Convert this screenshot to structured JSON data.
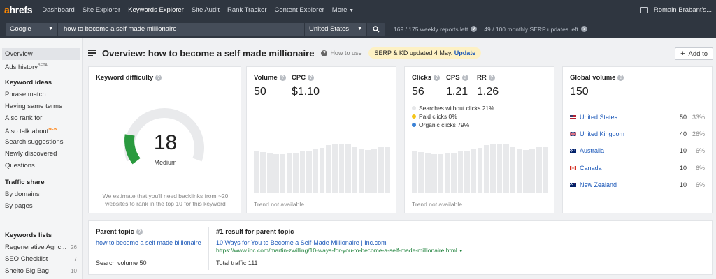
{
  "nav": {
    "logo_a": "a",
    "logo_rest": "hrefs",
    "links": [
      "Dashboard",
      "Site Explorer",
      "Keywords Explorer",
      "Site Audit",
      "Rank Tracker",
      "Content Explorer",
      "More"
    ],
    "user": "Romain Brabant's..."
  },
  "search": {
    "engine": "Google",
    "query": "how to become a self made millionaire",
    "country": "United States",
    "weekly_reports": "169 / 175 weekly reports left",
    "serp_updates": "49 / 100 monthly SERP updates left"
  },
  "sidebar": {
    "overview": "Overview",
    "ads_history": "Ads history",
    "ads_history_sup": "BETA",
    "keyword_ideas_head": "Keyword ideas",
    "keyword_ideas": [
      "Phrase match",
      "Having same terms",
      "Also rank for",
      "Also talk about",
      "Search suggestions",
      "Newly discovered",
      "Questions"
    ],
    "new_badge": "NEW",
    "traffic_share_head": "Traffic share",
    "traffic_share": [
      "By domains",
      "By pages"
    ],
    "keywords_lists_head": "Keywords lists",
    "lists": [
      {
        "name": "Regenerative Agric...",
        "count": "26"
      },
      {
        "name": "SEO Checklist",
        "count": "7"
      },
      {
        "name": "Shelto Big Bag",
        "count": "10"
      }
    ]
  },
  "header": {
    "title": "Overview: how to become a self made millionaire",
    "how_to_use": "How to use",
    "badge_text": "SERP & KD updated 4 May.",
    "badge_link": "Update",
    "add_to": "Add to"
  },
  "kd": {
    "title": "Keyword difficulty",
    "value": "18",
    "label": "Medium",
    "level": 0.18,
    "note": "We estimate that you'll need backlinks from ~20 websites to rank in the top 10 for this keyword"
  },
  "volume": {
    "title": "Volume",
    "value": "50",
    "cpc_title": "CPC",
    "cpc_value": "$1.10",
    "trend": "Trend not available",
    "bars": [
      0.52,
      0.51,
      0.5,
      0.49,
      0.49,
      0.5,
      0.5,
      0.52,
      0.53,
      0.56,
      0.57,
      0.6,
      0.62,
      0.62,
      0.62,
      0.58,
      0.55,
      0.54,
      0.55,
      0.58,
      0.58
    ]
  },
  "clicks": {
    "title": "Clicks",
    "value": "56",
    "cps_title": "CPS",
    "cps_value": "1.21",
    "rr_title": "RR",
    "rr_value": "1.26",
    "legend": [
      {
        "label": "Searches without clicks 21%",
        "color": "#e6e7e9"
      },
      {
        "label": "Paid clicks 0%",
        "color": "#f5c518"
      },
      {
        "label": "Organic clicks 79%",
        "color": "#3b82d6"
      }
    ],
    "trend": "Trend not available",
    "bars": [
      0.52,
      0.51,
      0.5,
      0.49,
      0.49,
      0.5,
      0.5,
      0.52,
      0.53,
      0.56,
      0.57,
      0.6,
      0.62,
      0.62,
      0.62,
      0.58,
      0.55,
      0.54,
      0.55,
      0.58,
      0.58
    ]
  },
  "global": {
    "title": "Global volume",
    "value": "150",
    "rows": [
      {
        "country": "United States",
        "vol": "50",
        "pct": "33%",
        "flag": "us"
      },
      {
        "country": "United Kingdom",
        "vol": "40",
        "pct": "26%",
        "flag": "uk"
      },
      {
        "country": "Australia",
        "vol": "10",
        "pct": "6%",
        "flag": "au"
      },
      {
        "country": "Canada",
        "vol": "10",
        "pct": "6%",
        "flag": "ca"
      },
      {
        "country": "New Zealand",
        "vol": "10",
        "pct": "6%",
        "flag": "nz"
      }
    ]
  },
  "parent": {
    "title": "Parent topic",
    "link": "how to become a self made billionaire",
    "search_volume": "Search volume 50",
    "result_title": "#1 result for parent topic",
    "result_link": "10 Ways for You to Become a Self-Made Millionaire | Inc.com",
    "result_url": "https://www.inc.com/martin-zwilling/10-ways-for-you-to-become-a-self-made-millionaire.html",
    "total_traffic": "Total traffic 111"
  },
  "colors": {
    "nav_bg": "#2f3640",
    "link": "#1a57b8",
    "url_green": "#1a7f37",
    "kd_green": "#2a9a3f",
    "badge_bg": "#fdf1c4"
  }
}
